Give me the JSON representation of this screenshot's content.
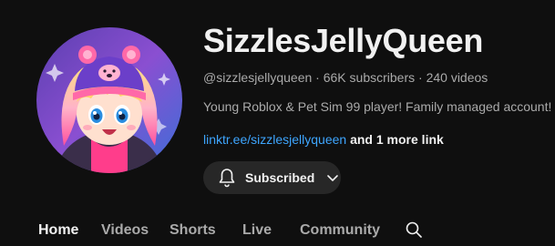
{
  "channel": {
    "name": "SizzlesJellyQueen",
    "handle": "@sizzlesjellyqueen",
    "sep1": " · ",
    "subscribers": "66K subscribers",
    "sep2": " · ",
    "videos": "240 videos",
    "description": "Young Roblox & Pet Sim 99 player! Family managed account!",
    "link": "linktr.ee/sizzlesjellyqueen",
    "more_links": "and 1 more link"
  },
  "subscribe_button": {
    "label": "Subscribed",
    "icons": [
      "bell-icon",
      "chevron-down-icon"
    ]
  },
  "tabs": [
    {
      "label": "Home",
      "active": true
    },
    {
      "label": "Videos",
      "active": false
    },
    {
      "label": "Shorts",
      "active": false
    },
    {
      "label": "Live",
      "active": false
    },
    {
      "label": "Community",
      "active": false
    }
  ],
  "colors": {
    "background": "#0f0f0f",
    "text_primary": "#f1f1f1",
    "text_secondary": "#aaaaaa",
    "link": "#3ea6ff",
    "button_bg": "#272727"
  }
}
